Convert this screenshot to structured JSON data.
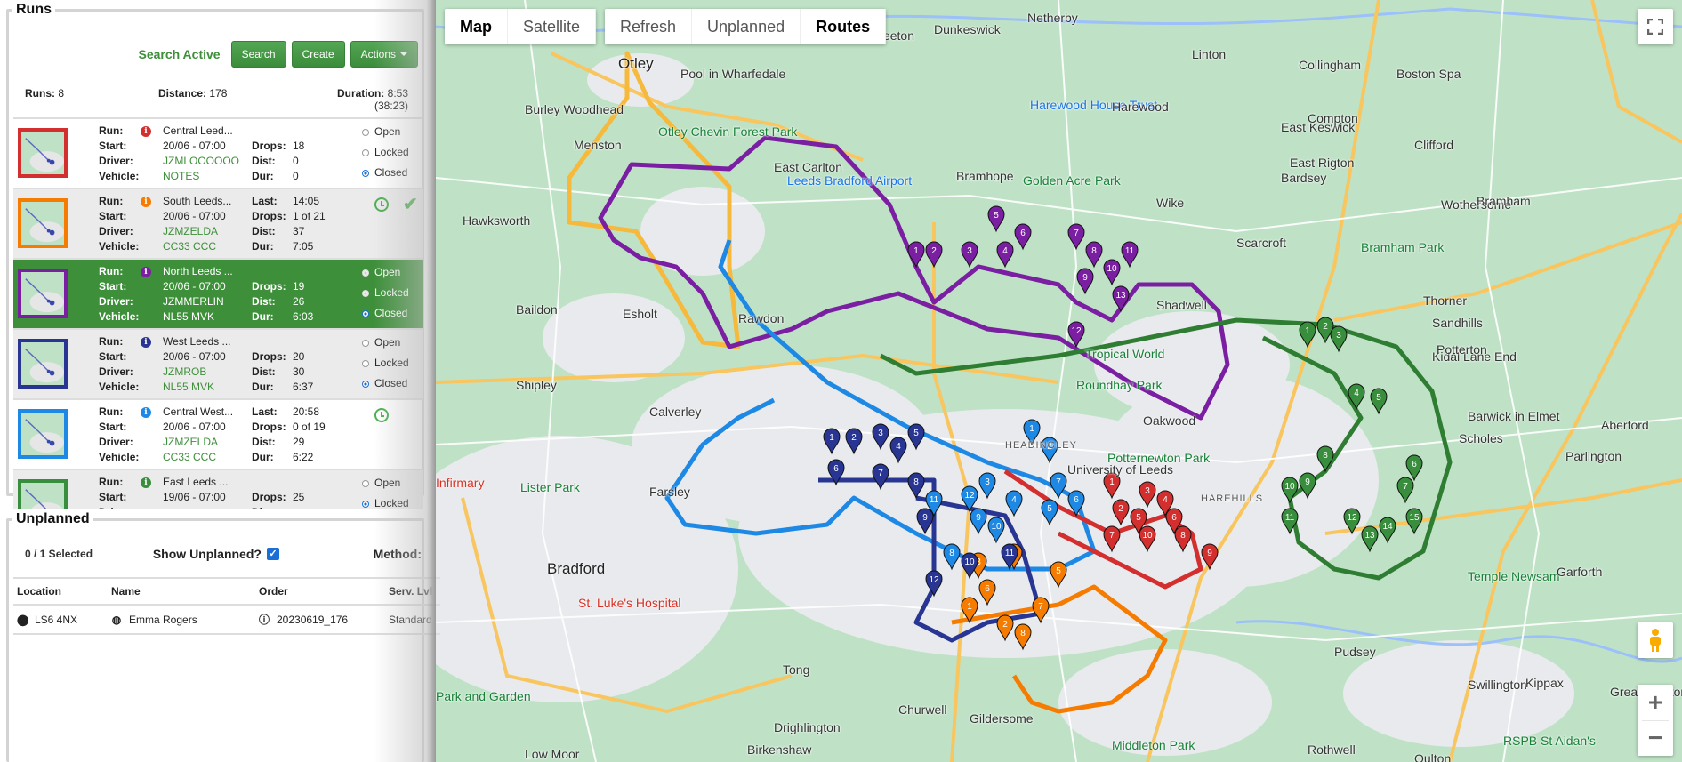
{
  "runs_panel": {
    "title": "Runs",
    "status": "Search Active",
    "buttons": {
      "search": "Search",
      "create": "Create",
      "actions": "Actions"
    },
    "summary": {
      "runs_label": "Runs:",
      "runs_value": "8",
      "distance_label": "Distance:",
      "distance_value": "178",
      "duration_label": "Duration:",
      "duration_value": "8:53 (38:23)"
    },
    "labels": {
      "run": "Run:",
      "start": "Start:",
      "driver": "Driver:",
      "vehicle": "Vehicle:",
      "last": "Last:",
      "drops": "Drops:",
      "dist": "Dist:",
      "dur": "Dur:"
    },
    "radio_labels": {
      "open": "Open",
      "locked": "Locked",
      "closed": "Closed"
    },
    "runs": [
      {
        "name": "Central Leed...",
        "color": "#d32f2f",
        "start": "20/06 - 07:00",
        "driver": "JZMLOOOOOO",
        "vehicle": "NOTES",
        "last": "",
        "drops": "18",
        "dist": "0",
        "dur": "0",
        "state": "closed",
        "in_progress": false,
        "complete": false
      },
      {
        "name": "South Leeds...",
        "color": "#f57c00",
        "start": "20/06 - 07:00",
        "driver": "JZMZELDA",
        "vehicle": "CC33 CCC",
        "last": "14:05",
        "drops": "1 of 21",
        "dist": "37",
        "dur": "7:05",
        "state": "",
        "in_progress": true,
        "complete": true
      },
      {
        "name": "North Leeds ...",
        "color": "#7b1fa2",
        "start": "20/06 - 07:00",
        "driver": "JZMMERLIN",
        "vehicle": "NL55 MVK",
        "last": "",
        "drops": "19",
        "dist": "26",
        "dur": "6:03",
        "state": "closed",
        "in_progress": false,
        "complete": false,
        "selected": true
      },
      {
        "name": "West Leeds ...",
        "color": "#283593",
        "start": "20/06 - 07:00",
        "driver": "JZMROB",
        "vehicle": "NL55 MVK",
        "last": "",
        "drops": "20",
        "dist": "30",
        "dur": "6:37",
        "state": "closed",
        "in_progress": false,
        "complete": false
      },
      {
        "name": "Central West...",
        "color": "#1e88e5",
        "start": "20/06 - 07:00",
        "driver": "JZMZELDA",
        "vehicle": "CC33 CCC",
        "last": "20:58",
        "drops": "0 of 19",
        "dist": "29",
        "dur": "6:22",
        "state": "",
        "in_progress": true,
        "complete": false
      },
      {
        "name": "East Leeds ...",
        "color": "#388e3c",
        "start": "19/06 - 07:00",
        "driver": "",
        "vehicle": "",
        "last": "",
        "drops": "25",
        "dist": "",
        "dur": "",
        "state": "locked",
        "in_progress": false,
        "complete": false
      }
    ]
  },
  "unplanned_panel": {
    "title": "Unplanned",
    "selected_count": "0 / 1 Selected",
    "show_label": "Show Unplanned?",
    "show_checked": true,
    "method_label": "Method:",
    "columns": [
      "Location",
      "Name",
      "Order",
      "Serv. Lvl"
    ],
    "rows": [
      {
        "location": "LS6 4NX",
        "name": "Emma Rogers",
        "order": "20230619_176",
        "service_level": "Standard"
      }
    ]
  },
  "map": {
    "type_options": [
      "Map",
      "Satellite"
    ],
    "selected_type": "Map",
    "toolbar": [
      "Refresh",
      "Unplanned",
      "Routes"
    ],
    "zoom_in": "+",
    "zoom_out": "−",
    "place_labels": [
      {
        "text": "Otley",
        "cls": "big"
      },
      {
        "text": "Burley Woodhead",
        "cls": ""
      },
      {
        "text": "Menston",
        "cls": ""
      },
      {
        "text": "Pool in Wharfedale",
        "cls": ""
      },
      {
        "text": "Weeton",
        "cls": ""
      },
      {
        "text": "Dunkeswick",
        "cls": ""
      },
      {
        "text": "Netherby",
        "cls": ""
      },
      {
        "text": "Linton",
        "cls": ""
      },
      {
        "text": "Collingham",
        "cls": ""
      },
      {
        "text": "Boston Spa",
        "cls": ""
      },
      {
        "text": "Harewood House Trust",
        "cls": "poi"
      },
      {
        "text": "Harewood",
        "cls": ""
      },
      {
        "text": "Otley Chevin Forest Park",
        "cls": "park"
      },
      {
        "text": "East Carlton",
        "cls": ""
      },
      {
        "text": "Leeds Bradford Airport",
        "cls": "poi"
      },
      {
        "text": "Bramhope",
        "cls": ""
      },
      {
        "text": "Golden Acre Park",
        "cls": "park"
      },
      {
        "text": "Hawksworth",
        "cls": ""
      },
      {
        "text": "Wike",
        "cls": ""
      },
      {
        "text": "East Keswick",
        "cls": ""
      },
      {
        "text": "Compton",
        "cls": ""
      },
      {
        "text": "East Rigton",
        "cls": ""
      },
      {
        "text": "Bardsey",
        "cls": ""
      },
      {
        "text": "Clifford",
        "cls": ""
      },
      {
        "text": "Wothersome",
        "cls": ""
      },
      {
        "text": "Bramham",
        "cls": ""
      },
      {
        "text": "Scarcroft",
        "cls": ""
      },
      {
        "text": "Bramham Park",
        "cls": "park"
      },
      {
        "text": "Baildon",
        "cls": ""
      },
      {
        "text": "Esholt",
        "cls": ""
      },
      {
        "text": "Rawdon",
        "cls": ""
      },
      {
        "text": "Shadwell",
        "cls": ""
      },
      {
        "text": "Thorner",
        "cls": ""
      },
      {
        "text": "Sandhills",
        "cls": ""
      },
      {
        "text": "Kidal Lane End",
        "cls": ""
      },
      {
        "text": "Potterton",
        "cls": ""
      },
      {
        "text": "Shipley",
        "cls": ""
      },
      {
        "text": "Tropical World",
        "cls": "park"
      },
      {
        "text": "Roundhay Park",
        "cls": "park"
      },
      {
        "text": "Calverley",
        "cls": ""
      },
      {
        "text": "Oakwood",
        "cls": ""
      },
      {
        "text": "Scholes",
        "cls": ""
      },
      {
        "text": "Barwick in Elmet",
        "cls": ""
      },
      {
        "text": "Parlington",
        "cls": ""
      },
      {
        "text": "Aberford",
        "cls": ""
      },
      {
        "text": "HEADINGLEY",
        "cls": "small"
      },
      {
        "text": "University of Leeds",
        "cls": ""
      },
      {
        "text": "Potternewton Park",
        "cls": "park"
      },
      {
        "text": "HAREHILLS",
        "cls": "small"
      },
      {
        "text": "Lister Park",
        "cls": "park"
      },
      {
        "text": "Farsley",
        "cls": ""
      },
      {
        "text": "Bradford",
        "cls": "big"
      },
      {
        "text": "St. Luke's Hospital",
        "cls": "hosp"
      },
      {
        "text": "Pudsey",
        "cls": ""
      },
      {
        "text": "Temple Newsam",
        "cls": "park"
      },
      {
        "text": "Garforth",
        "cls": ""
      },
      {
        "text": "Tong",
        "cls": ""
      },
      {
        "text": "Swillington",
        "cls": ""
      },
      {
        "text": "Kippax",
        "cls": ""
      },
      {
        "text": "Churwell",
        "cls": ""
      },
      {
        "text": "Gildersome",
        "cls": ""
      },
      {
        "text": "Drighlington",
        "cls": ""
      },
      {
        "text": "Birkenshaw",
        "cls": ""
      },
      {
        "text": "Low Moor",
        "cls": ""
      },
      {
        "text": "Rothwell",
        "cls": ""
      },
      {
        "text": "Great Preston",
        "cls": ""
      },
      {
        "text": "Middleton Park",
        "cls": "park"
      },
      {
        "text": "Oulton",
        "cls": ""
      },
      {
        "text": "RSPB St Aidan's",
        "cls": "park"
      },
      {
        "text": "Park and Garden",
        "cls": "park"
      },
      {
        "text": "Infirmary",
        "cls": "hosp"
      }
    ]
  }
}
